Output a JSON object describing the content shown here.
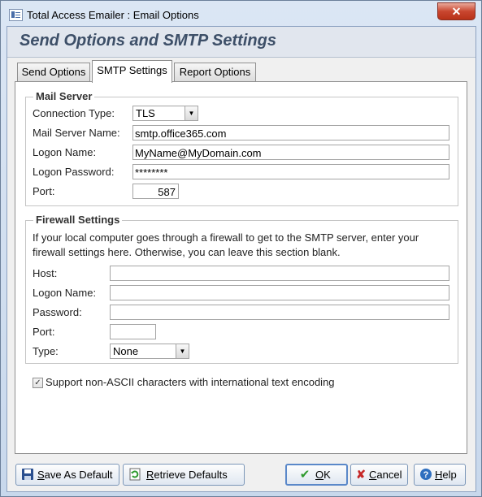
{
  "window": {
    "title": "Total Access Emailer : Email Options",
    "close_symbol": "✕"
  },
  "header": {
    "title": "Send Options and SMTP Settings"
  },
  "tabs": [
    {
      "label": "Send Options"
    },
    {
      "label": "SMTP Settings"
    },
    {
      "label": "Report Options"
    }
  ],
  "mail_server": {
    "title": "Mail Server",
    "connection_type_label": "Connection Type:",
    "connection_type_value": "TLS",
    "server_name_label": "Mail Server Name:",
    "server_name_value": "smtp.office365.com",
    "logon_name_label": "Logon Name:",
    "logon_name_value": "MyName@MyDomain.com",
    "logon_password_label": "Logon Password:",
    "logon_password_value": "********",
    "port_label": "Port:",
    "port_value": "587"
  },
  "firewall": {
    "title": "Firewall Settings",
    "description_line1": "If your local computer goes through a firewall to get to the SMTP server, enter your",
    "description_line2": "firewall settings here. Otherwise, you can leave this section blank.",
    "host_label": "Host:",
    "host_value": "",
    "logon_name_label": "Logon Name:",
    "logon_name_value": "",
    "password_label": "Password:",
    "password_value": "",
    "port_label": "Port:",
    "port_value": "",
    "type_label": "Type:",
    "type_value": "None"
  },
  "unicode_option": {
    "label": "Support non-ASCII characters with international text encoding",
    "checked": true
  },
  "buttons": {
    "save_default": {
      "u": "S",
      "rest": "ave As Default"
    },
    "retrieve_defaults": {
      "u": "R",
      "rest": "etrieve Defaults"
    },
    "ok": {
      "u": "O",
      "rest": "K"
    },
    "cancel": {
      "u": "C",
      "rest": "ancel"
    },
    "help": {
      "u": "H",
      "rest": "elp"
    }
  },
  "colors": {
    "header_text": "#3d4f68",
    "close_button": "#c9462f",
    "ok_check": "#2e9a2e",
    "cancel_x": "#c62828"
  }
}
